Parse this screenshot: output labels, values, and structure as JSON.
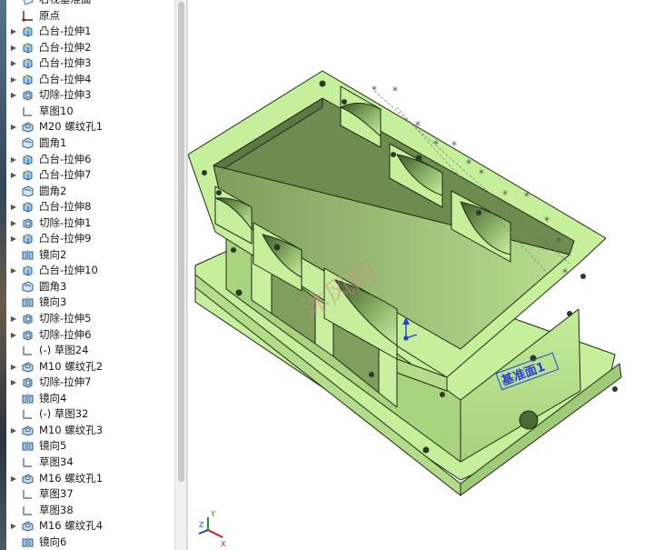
{
  "feature_tree": {
    "items": [
      {
        "label": "右视基准面",
        "icon": "plane-icon",
        "expandable": false
      },
      {
        "label": "原点",
        "icon": "origin-icon",
        "expandable": false
      },
      {
        "label": "凸台-拉伸1",
        "icon": "boss-extrude-icon",
        "expandable": true
      },
      {
        "label": "凸台-拉伸2",
        "icon": "boss-extrude-icon",
        "expandable": true
      },
      {
        "label": "凸台-拉伸3",
        "icon": "boss-extrude-icon",
        "expandable": true
      },
      {
        "label": "凸台-拉伸4",
        "icon": "boss-extrude-icon",
        "expandable": true
      },
      {
        "label": "切除-拉伸3",
        "icon": "cut-extrude-icon",
        "expandable": true
      },
      {
        "label": "草图10",
        "icon": "sketch-icon",
        "expandable": false
      },
      {
        "label": "M20 螺纹孔1",
        "icon": "hole-wizard-icon",
        "expandable": true
      },
      {
        "label": "圆角1",
        "icon": "fillet-icon",
        "expandable": false
      },
      {
        "label": "凸台-拉伸6",
        "icon": "boss-extrude-icon",
        "expandable": true
      },
      {
        "label": "凸台-拉伸7",
        "icon": "boss-extrude-icon",
        "expandable": true
      },
      {
        "label": "圆角2",
        "icon": "fillet-icon",
        "expandable": false
      },
      {
        "label": "凸台-拉伸8",
        "icon": "boss-extrude-icon",
        "expandable": true
      },
      {
        "label": "切除-拉伸1",
        "icon": "cut-extrude-icon",
        "expandable": true
      },
      {
        "label": "凸台-拉伸9",
        "icon": "boss-extrude-icon",
        "expandable": true
      },
      {
        "label": "镜向2",
        "icon": "mirror-icon",
        "expandable": false
      },
      {
        "label": "凸台-拉伸10",
        "icon": "boss-extrude-icon",
        "expandable": true
      },
      {
        "label": "圆角3",
        "icon": "fillet-icon",
        "expandable": false
      },
      {
        "label": "镜向3",
        "icon": "mirror-icon",
        "expandable": false
      },
      {
        "label": "切除-拉伸5",
        "icon": "cut-extrude-icon",
        "expandable": true
      },
      {
        "label": "切除-拉伸6",
        "icon": "cut-extrude-icon",
        "expandable": true
      },
      {
        "label": "(-) 草图24",
        "icon": "sketch-icon",
        "expandable": false
      },
      {
        "label": "M10 螺纹孔2",
        "icon": "hole-wizard-icon",
        "expandable": true
      },
      {
        "label": "切除-拉伸7",
        "icon": "cut-extrude-icon",
        "expandable": true
      },
      {
        "label": "镜向4",
        "icon": "mirror-icon",
        "expandable": false
      },
      {
        "label": "(-) 草图32",
        "icon": "sketch-icon",
        "expandable": false
      },
      {
        "label": "M10 螺纹孔3",
        "icon": "hole-wizard-icon",
        "expandable": true
      },
      {
        "label": "镜向5",
        "icon": "mirror-icon",
        "expandable": false
      },
      {
        "label": "草图34",
        "icon": "sketch-icon",
        "expandable": false
      },
      {
        "label": "M16 螺纹孔1",
        "icon": "hole-wizard-icon",
        "expandable": true
      },
      {
        "label": "草图37",
        "icon": "sketch-icon",
        "expandable": false
      },
      {
        "label": "草图38",
        "icon": "sketch-icon",
        "expandable": false
      },
      {
        "label": "M16 螺纹孔4",
        "icon": "hole-wizard-icon",
        "expandable": true
      },
      {
        "label": "镜向6",
        "icon": "mirror-icon",
        "expandable": false
      }
    ]
  },
  "viewport": {
    "plane_label": "基准面1",
    "watermark": "沐风网",
    "triad": {
      "x": "X",
      "y": "Y",
      "z": "Z"
    },
    "colors": {
      "body": "#c6ef9c",
      "body_dark": "#a9d582",
      "body_shadow": "#8fbf6a",
      "inner": "#7fa05c",
      "edge": "#1e2a14",
      "plane": "#2b3fd8",
      "watermark": "#d88a8a"
    }
  }
}
